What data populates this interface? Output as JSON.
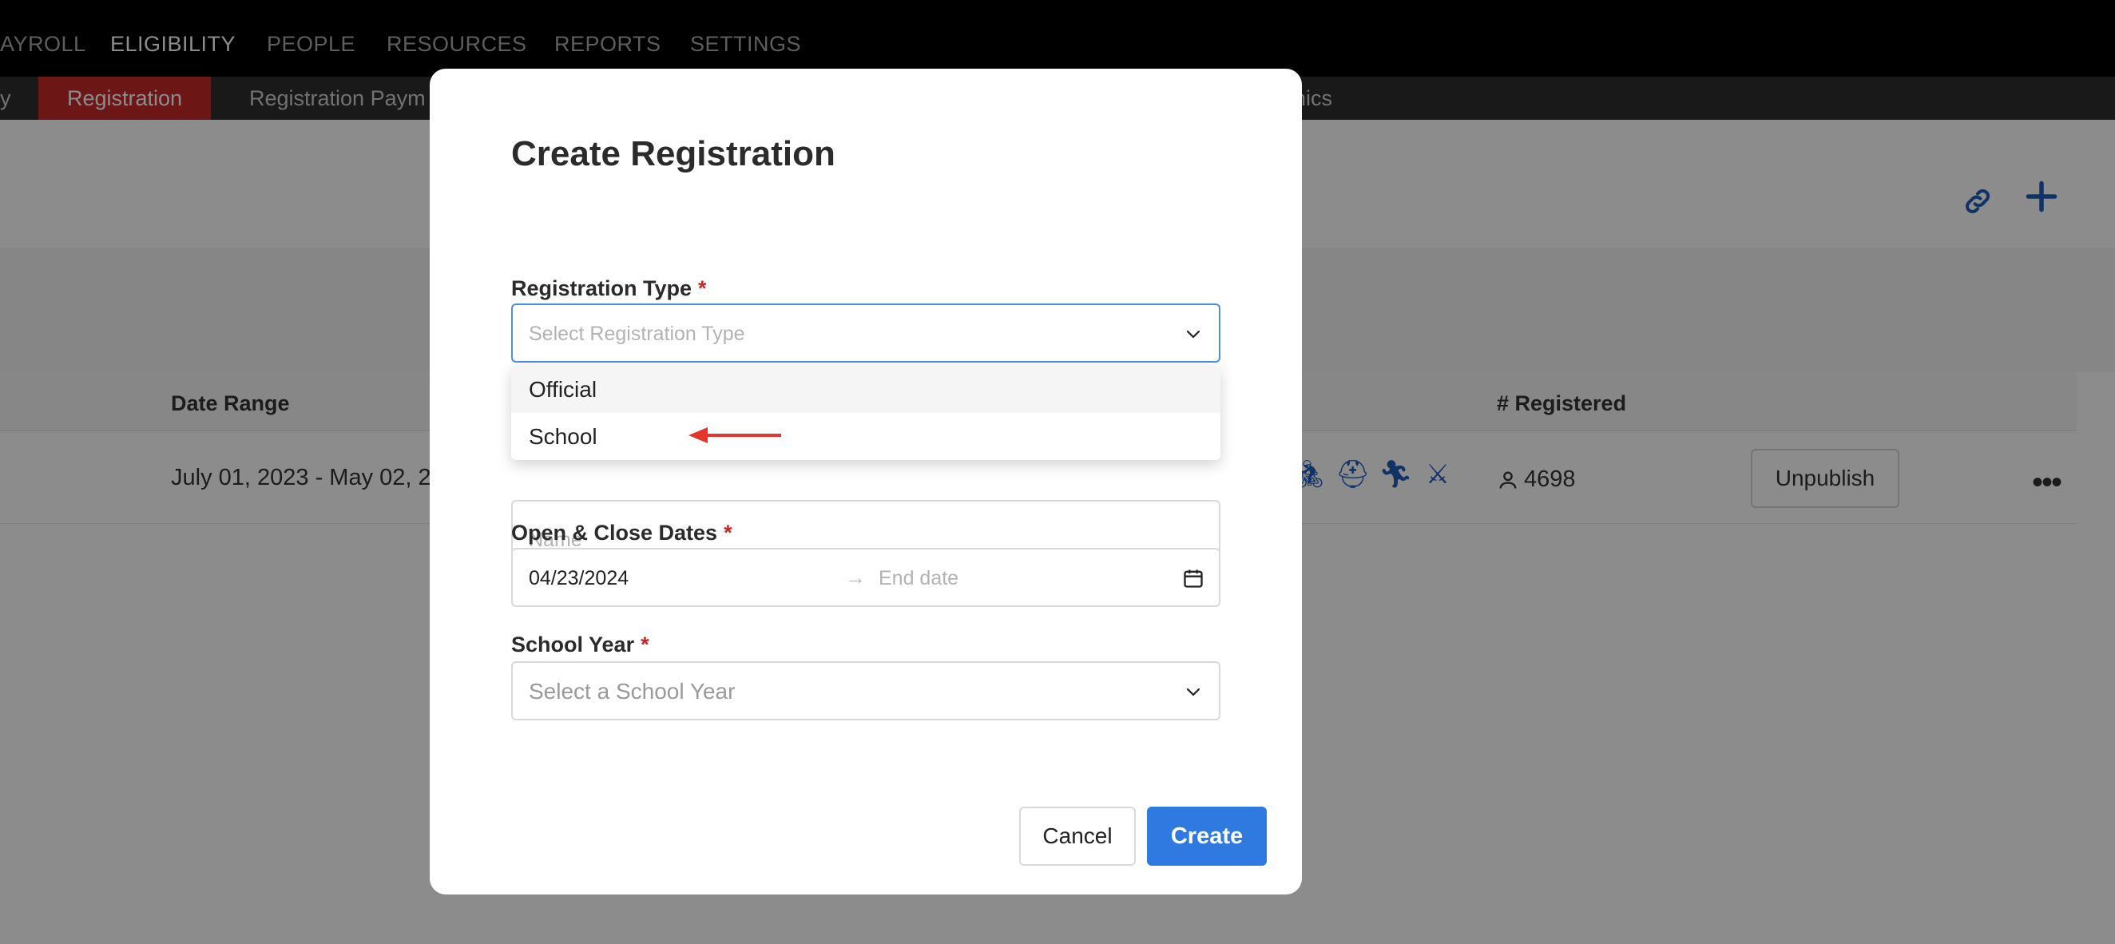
{
  "top_nav": {
    "items": [
      {
        "label": "AYROLL",
        "active": false
      },
      {
        "label": "ELIGIBILITY",
        "active": true
      },
      {
        "label": "PEOPLE",
        "active": false
      },
      {
        "label": "RESOURCES",
        "active": false
      },
      {
        "label": "REPORTS",
        "active": false
      },
      {
        "label": "SETTINGS",
        "active": false
      }
    ]
  },
  "sub_nav": {
    "items": [
      {
        "label": "y",
        "active": false
      },
      {
        "label": "Registration",
        "active": true
      },
      {
        "label": "Registration Paym",
        "active": false
      },
      {
        "label": "nics",
        "active": false
      }
    ]
  },
  "table": {
    "headers": {
      "date_range": "Date Range",
      "registered": "# Registered"
    },
    "row": {
      "date_range": "July 01, 2023 - May 02, 2",
      "registered_count": "4698",
      "unpublish_label": "Unpublish"
    }
  },
  "modal": {
    "title": "Create Registration",
    "registration_type": {
      "label": "Registration Type",
      "required_mark": "*",
      "placeholder": "Select Registration Type",
      "options": [
        "Official",
        "School"
      ]
    },
    "name_field": {
      "placeholder": "Name"
    },
    "dates": {
      "label": "Open & Close Dates",
      "required_mark": "*",
      "start_value": "04/23/2024",
      "separator": "→",
      "end_placeholder": "End date"
    },
    "school_year": {
      "label": "School Year",
      "required_mark": "*",
      "placeholder": "Select a School Year"
    },
    "cancel_label": "Cancel",
    "create_label": "Create"
  },
  "colors": {
    "accent": "#2f7ae0",
    "active_tab": "#c62828",
    "required": "#c62828",
    "icon_blue": "#1e5bb8"
  }
}
